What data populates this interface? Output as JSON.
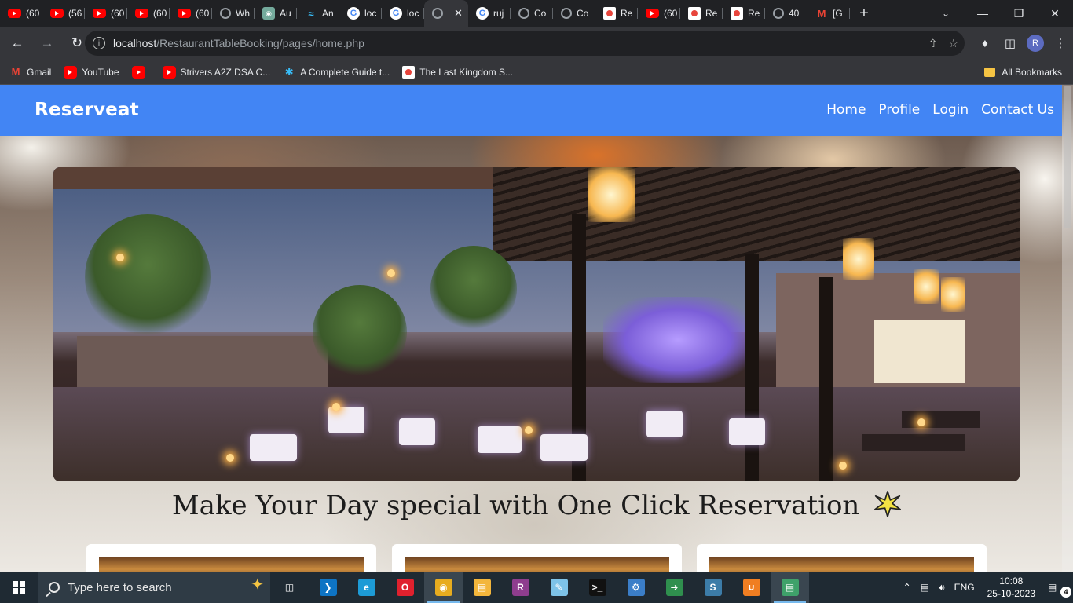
{
  "browser": {
    "tabs": [
      {
        "icon": "youtube-icon",
        "label": "(60"
      },
      {
        "icon": "youtube-icon",
        "label": "(56"
      },
      {
        "icon": "youtube-icon",
        "label": "(60"
      },
      {
        "icon": "youtube-icon",
        "label": "(60"
      },
      {
        "icon": "youtube-icon",
        "label": "(60"
      },
      {
        "icon": "globe-icon",
        "label": "Wh"
      },
      {
        "icon": "chatgpt-icon",
        "label": "Au"
      },
      {
        "icon": "tailwind-icon",
        "label": "An"
      },
      {
        "icon": "google-icon",
        "label": "loc"
      },
      {
        "icon": "google-icon",
        "label": "loc"
      },
      {
        "icon": "globe-icon",
        "label": ""
      },
      {
        "icon": "google-icon",
        "label": "ruj"
      },
      {
        "icon": "globe-icon",
        "label": "Co"
      },
      {
        "icon": "globe-icon",
        "label": "Co"
      },
      {
        "icon": "app-icon",
        "label": "Re"
      },
      {
        "icon": "youtube-icon",
        "label": "(60"
      },
      {
        "icon": "app-icon",
        "label": "Re"
      },
      {
        "icon": "app-icon",
        "label": "Re"
      },
      {
        "icon": "globe-icon",
        "label": "40"
      },
      {
        "icon": "gmail-icon",
        "label": "[G"
      }
    ],
    "active_tab_index": 10,
    "new_tab_label": "+",
    "url_host": "localhost",
    "url_path": "/RestaurantTableBooking/pages/home.php",
    "profile_initial": "R",
    "bookmarks": [
      {
        "icon": "gmail-icon",
        "label": "Gmail"
      },
      {
        "icon": "youtube-icon",
        "label": "YouTube"
      },
      {
        "icon": "youtube-icon",
        "label": ""
      },
      {
        "icon": "tuf-icon",
        "label": "Strivers A2Z DSA C..."
      },
      {
        "icon": "asterisk-icon",
        "label": "A Complete Guide t..."
      },
      {
        "icon": "film-icon",
        "label": "The Last Kingdom S..."
      }
    ],
    "all_bookmarks_label": "All Bookmarks"
  },
  "site": {
    "brand": "Reserveat",
    "nav": [
      "Home",
      "Profile",
      "Login",
      "Contact Us"
    ],
    "tagline": "Make Your Day special with One Click Reservation"
  },
  "taskbar": {
    "search_placeholder": "Type here to search",
    "apps": [
      {
        "icon": "task-view-icon",
        "active": false
      },
      {
        "icon": "vscode-icon",
        "active": false
      },
      {
        "icon": "edge-icon",
        "active": false
      },
      {
        "icon": "opera-icon",
        "active": false
      },
      {
        "icon": "chrome-icon",
        "active": true
      },
      {
        "icon": "file-explorer-icon",
        "active": false
      },
      {
        "icon": "winrar-icon",
        "active": false
      },
      {
        "icon": "notepad-icon",
        "active": false
      },
      {
        "icon": "terminal-icon",
        "active": false
      },
      {
        "icon": "control-panel-icon",
        "active": false
      },
      {
        "icon": "app-arrow-icon",
        "active": false
      },
      {
        "icon": "mysql-icon",
        "active": false
      },
      {
        "icon": "xampp-icon",
        "active": false
      },
      {
        "icon": "app-window-icon",
        "active": true
      }
    ],
    "language": "ENG",
    "time": "10:08",
    "date": "25-10-2023",
    "notification_count": "4"
  },
  "colors": {
    "navbar": "#4285f4",
    "chrome_dark": "#202124",
    "taskbar": "#1f2a33"
  }
}
